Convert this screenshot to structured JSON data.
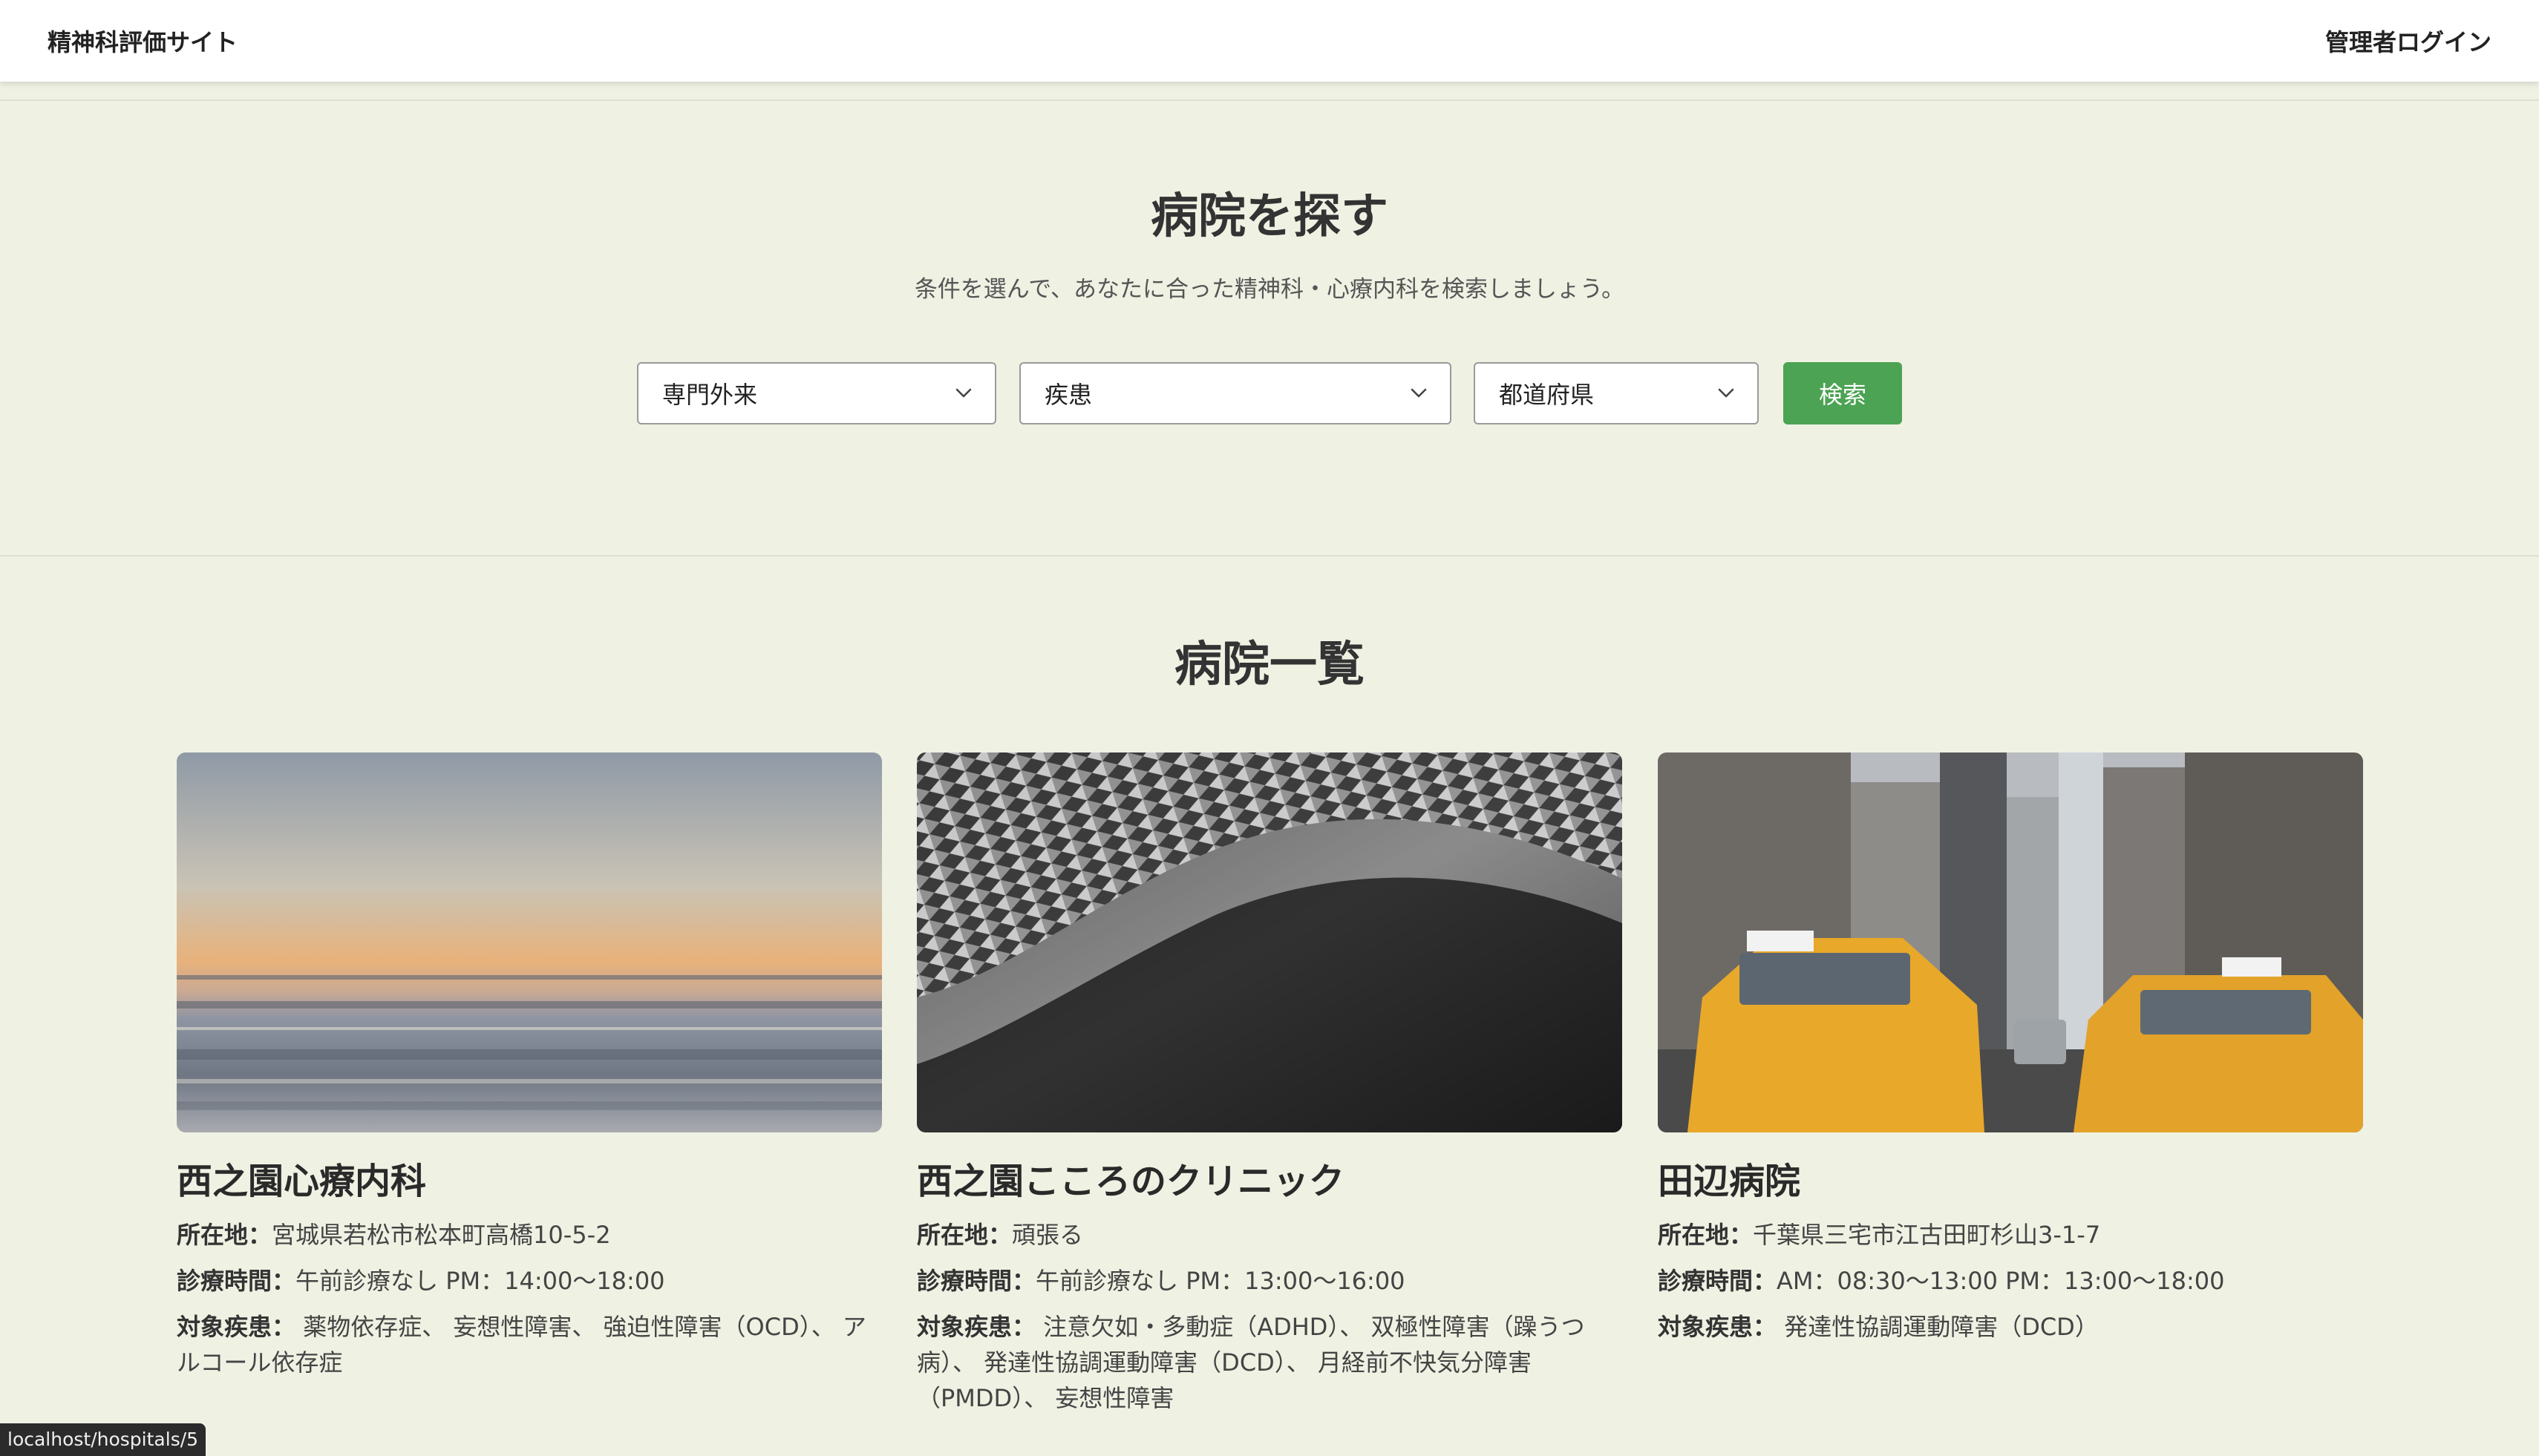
{
  "nav": {
    "brand": "精神科評価サイト",
    "admin_login": "管理者ログイン"
  },
  "search": {
    "title": "病院を探す",
    "subtitle": "条件を選んで、あなたに合った精神科・心療内科を検索しましょう。",
    "specialty_select": "専門外来",
    "disease_select": "疾患",
    "prefecture_select": "都道府県",
    "search_button": "検索"
  },
  "hospitals": {
    "title": "病院一覧",
    "location_label": "所在地：",
    "hours_label": "診療時間：",
    "diseases_label": "対象疾患：",
    "items": [
      {
        "name": "西之園心療内科",
        "location": "宮城県若松市松本町高橋10-5-2",
        "hours": "午前診療なし PM：14:00〜18:00",
        "diseases": "薬物依存症、 妄想性障害、 強迫性障害（OCD）、 アルコール依存症",
        "image": "sunset-seascape-photo"
      },
      {
        "name": "西之園こころのクリニック",
        "location": "頑張る",
        "hours": "午前診療なし PM：13:00〜16:00",
        "diseases": "注意欠如・多動症（ADHD）、 双極性障害（躁うつ病）、 発達性協調運動障害（DCD）、 月経前不快気分障害（PMDD）、 妄想性障害",
        "image": "abstract-architecture-photo"
      },
      {
        "name": "田辺病院",
        "location": "千葉県三宅市江古田町杉山3-1-7",
        "hours": "AM：08:30〜13:00 PM：13:00〜18:00",
        "diseases": "発達性協調運動障害（DCD）",
        "image": "city-taxi-photo"
      }
    ]
  },
  "status_bar": "localhost/hospitals/5",
  "colors": {
    "background": "#eff1e3",
    "button": "#4ca353",
    "navbar": "#ffffff"
  }
}
